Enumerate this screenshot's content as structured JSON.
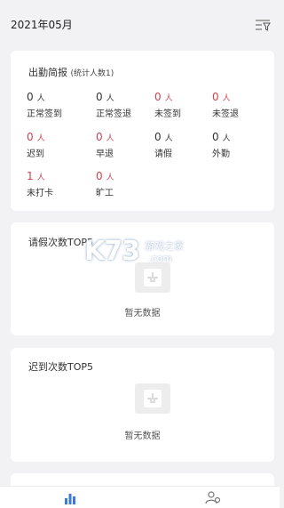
{
  "header": {
    "month": "2021年05月"
  },
  "summary": {
    "title": "出勤简报",
    "subtitle": "(统计人数1)",
    "unit": "人",
    "stats": [
      {
        "value": "0",
        "label": "正常签到"
      },
      {
        "value": "0",
        "label": "正常签退"
      },
      {
        "value": "0",
        "label": "未签到"
      },
      {
        "value": "0",
        "label": "未签退"
      },
      {
        "value": "0",
        "label": "迟到"
      },
      {
        "value": "0",
        "label": "早退"
      },
      {
        "value": "0",
        "label": "请假"
      },
      {
        "value": "0",
        "label": "外勤"
      },
      {
        "value": "1",
        "label": "未打卡"
      },
      {
        "value": "0",
        "label": "旷工"
      }
    ]
  },
  "leave_top5": {
    "title": "请假次数TOP5",
    "empty_text": "暂无数据"
  },
  "late_top5": {
    "title": "迟到次数TOP5",
    "empty_text": "暂无数据"
  },
  "watermark": {
    "brand": "K73",
    "cn": "游戏之家",
    "domain": ".com"
  },
  "tabs": [
    {
      "icon": "bar-chart-icon"
    },
    {
      "icon": "people-settings-icon"
    }
  ],
  "colors": {
    "accent": "#3d7bd8",
    "red": "#d0434d"
  }
}
